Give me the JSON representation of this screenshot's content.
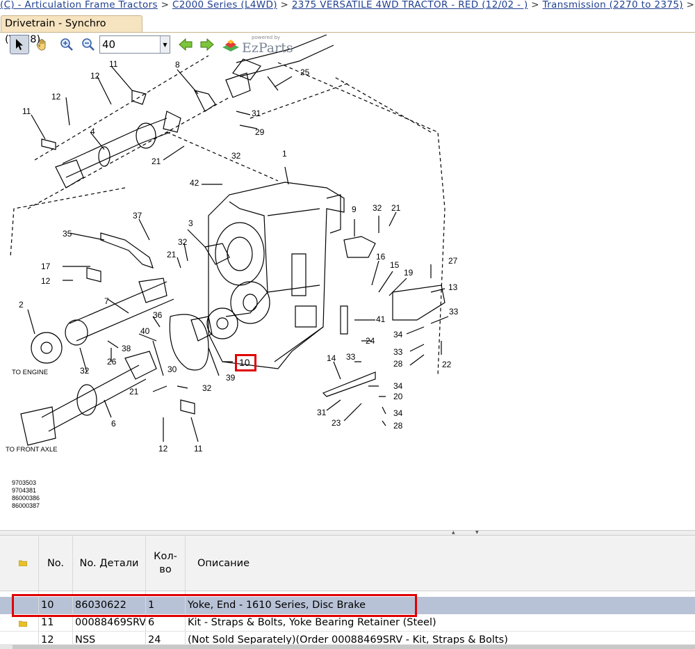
{
  "breadcrumb": {
    "items": [
      "(C) - Articulation Frame Tractors",
      "C2000 Series (L4WD)",
      "2375 VERSATILE 4WD TRACTOR - RED (12/02 - )",
      "Transmission (2270 to 2375)"
    ],
    "separator": ">"
  },
  "tab": {
    "title": "Drivetrain - Synchro (TM78)"
  },
  "toolbar": {
    "zoom_value": "40",
    "icons": [
      "pointer-arrow-icon",
      "hand-pan-icon",
      "zoom-in-icon",
      "zoom-out-icon",
      "back-arrow-icon",
      "forward-arrow-icon"
    ]
  },
  "brand": {
    "powered_by": "powered by",
    "name": "EzParts"
  },
  "drawing": {
    "callouts": [
      "1",
      "2",
      "3",
      "4",
      "6",
      "7",
      "8",
      "9",
      "10",
      "11",
      "12",
      "13",
      "14",
      "15",
      "16",
      "17",
      "19",
      "20",
      "21",
      "22",
      "23",
      "24",
      "25",
      "26",
      "27",
      "28",
      "29",
      "30",
      "31",
      "32",
      "33",
      "34",
      "35",
      "36",
      "37",
      "38",
      "39",
      "40",
      "41",
      "42"
    ],
    "selected_callout": "10",
    "labels": {
      "to_engine": "TO ENGINE",
      "to_front_axle": "TO FRONT AXLE"
    },
    "reference_numbers": [
      "9703503",
      "9704381",
      "86000386",
      "86000387"
    ]
  },
  "table": {
    "columns": {
      "no": "No.",
      "part": "No. Детали",
      "qty": "Кол-во",
      "desc": "Описание"
    },
    "rows": [
      {
        "no": "10",
        "part": "86030622",
        "qty": "1",
        "desc": "Yoke, End - 1610 Series, Disc Brake",
        "selected": true
      },
      {
        "no": "11",
        "part": "00088469SRV",
        "qty": "6",
        "desc": "Kit - Straps & Bolts, Yoke Bearing Retainer (Steel)",
        "selected": false
      },
      {
        "no": "12",
        "part": "NSS",
        "qty": "24",
        "desc": "(Not Sold Separately)(Order 00088469SRV - Kit, Straps & Bolts)",
        "selected": false
      }
    ]
  },
  "colors": {
    "link": "#1f3f8f",
    "tab_bg": "#f6e3bf",
    "selection_row": "#b8c2d6",
    "highlight_red": "#e00000"
  }
}
